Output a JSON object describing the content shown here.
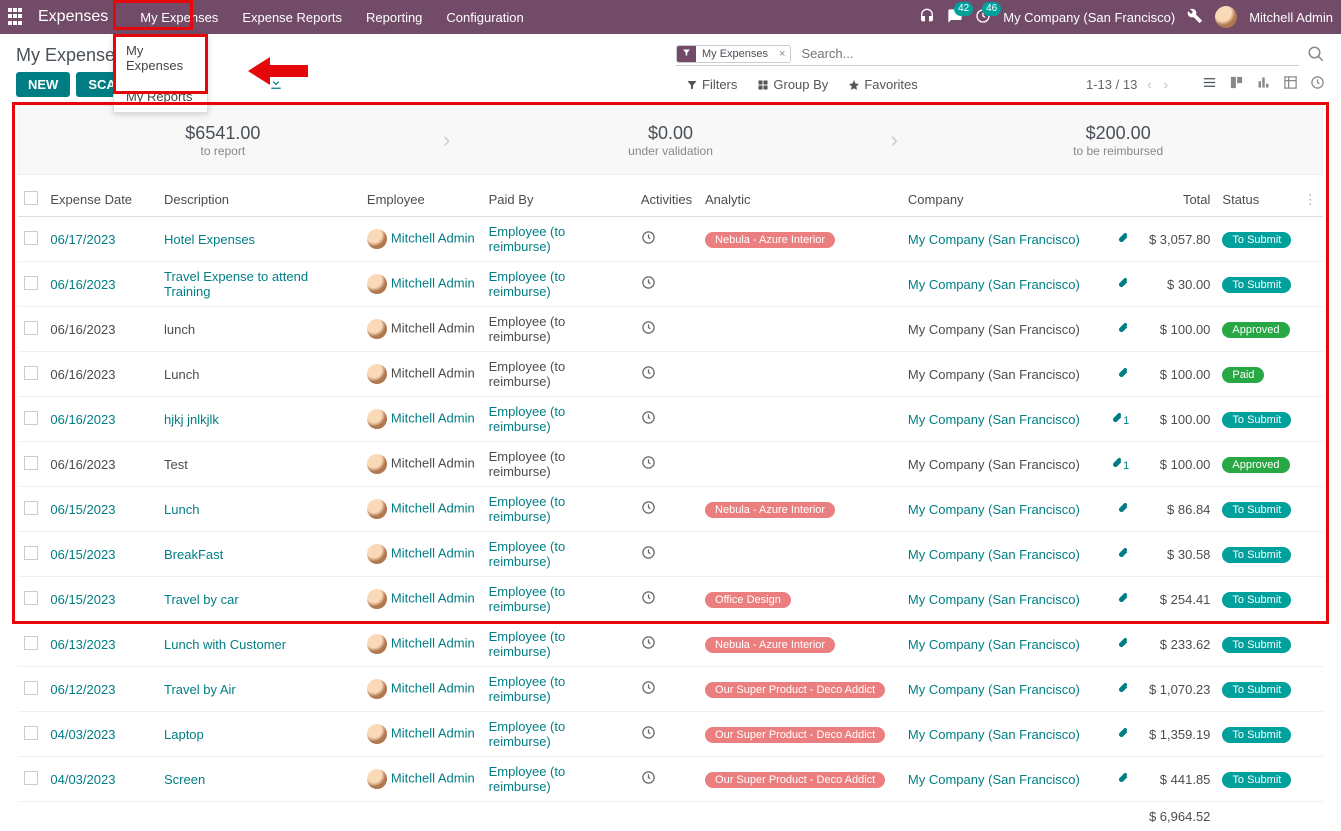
{
  "navbar": {
    "app_name": "Expenses",
    "menus": [
      "My Expenses",
      "Expense Reports",
      "Reporting",
      "Configuration"
    ],
    "chat_badge": "42",
    "activity_badge": "46",
    "company": "My Company (San Francisco)",
    "user": "Mitchell Admin"
  },
  "dropdown": {
    "items": [
      "My Expenses",
      "My Reports"
    ]
  },
  "control_panel": {
    "breadcrumb": "My Expenses",
    "new_btn": "NEW",
    "scan_btn": "SCAN",
    "filter_tag": "My Expenses",
    "search_placeholder": "Search...",
    "filters": "Filters",
    "group_by": "Group By",
    "favorites": "Favorites",
    "pager": "1-13 / 13"
  },
  "summary": [
    {
      "amount": "$6541.00",
      "label": "to report"
    },
    {
      "amount": "$0.00",
      "label": "under validation"
    },
    {
      "amount": "$200.00",
      "label": "to be reimbursed"
    }
  ],
  "columns": {
    "date": "Expense Date",
    "desc": "Description",
    "emp": "Employee",
    "paid": "Paid By",
    "act": "Activities",
    "ana": "Analytic",
    "comp": "Company",
    "total": "Total",
    "status": "Status"
  },
  "rows": [
    {
      "date": "06/17/2023",
      "desc": "Hotel Expenses",
      "emp": "Mitchell Admin",
      "paid": "Employee (to reimburse)",
      "ana": "Nebula - Azure Interior",
      "comp": "My Company (San Francisco)",
      "clip": "1",
      "clip_n": "",
      "total": "$ 3,057.80",
      "status": "To Submit",
      "status_cls": "to-submit",
      "date_link": true,
      "desc_link": true,
      "emp_link": true,
      "paid_link": true,
      "comp_link": true
    },
    {
      "date": "06/16/2023",
      "desc": "Travel Expense to attend Training",
      "emp": "Mitchell Admin",
      "paid": "Employee (to reimburse)",
      "ana": "",
      "comp": "My Company (San Francisco)",
      "clip": "1",
      "clip_n": "",
      "total": "$ 30.00",
      "status": "To Submit",
      "status_cls": "to-submit",
      "date_link": true,
      "desc_link": true,
      "emp_link": true,
      "paid_link": true,
      "comp_link": true
    },
    {
      "date": "06/16/2023",
      "desc": "lunch",
      "emp": "Mitchell Admin",
      "paid": "Employee (to reimburse)",
      "ana": "",
      "comp": "My Company (San Francisco)",
      "clip": "1",
      "clip_n": "",
      "total": "$ 100.00",
      "status": "Approved",
      "status_cls": "approved",
      "date_link": false,
      "desc_link": false,
      "emp_link": false,
      "paid_link": false,
      "comp_link": false
    },
    {
      "date": "06/16/2023",
      "desc": "Lunch",
      "emp": "Mitchell Admin",
      "paid": "Employee (to reimburse)",
      "ana": "",
      "comp": "My Company (San Francisco)",
      "clip": "1",
      "clip_n": "",
      "total": "$ 100.00",
      "status": "Paid",
      "status_cls": "paid",
      "date_link": false,
      "desc_link": false,
      "emp_link": false,
      "paid_link": false,
      "comp_link": false
    },
    {
      "date": "06/16/2023",
      "desc": "hjkj jnlkjlk",
      "emp": "Mitchell Admin",
      "paid": "Employee (to reimburse)",
      "ana": "",
      "comp": "My Company (San Francisco)",
      "clip": "1",
      "clip_n": "1",
      "total": "$ 100.00",
      "status": "To Submit",
      "status_cls": "to-submit",
      "date_link": true,
      "desc_link": true,
      "emp_link": true,
      "paid_link": true,
      "comp_link": true
    },
    {
      "date": "06/16/2023",
      "desc": "Test",
      "emp": "Mitchell Admin",
      "paid": "Employee (to reimburse)",
      "ana": "",
      "comp": "My Company (San Francisco)",
      "clip": "1",
      "clip_n": "1",
      "total": "$ 100.00",
      "status": "Approved",
      "status_cls": "approved",
      "date_link": false,
      "desc_link": false,
      "emp_link": false,
      "paid_link": false,
      "comp_link": false
    },
    {
      "date": "06/15/2023",
      "desc": "Lunch",
      "emp": "Mitchell Admin",
      "paid": "Employee (to reimburse)",
      "ana": "Nebula - Azure Interior",
      "comp": "My Company (San Francisco)",
      "clip": "1",
      "clip_n": "",
      "total": "$ 86.84",
      "status": "To Submit",
      "status_cls": "to-submit",
      "date_link": true,
      "desc_link": true,
      "emp_link": true,
      "paid_link": true,
      "comp_link": true
    },
    {
      "date": "06/15/2023",
      "desc": "BreakFast",
      "emp": "Mitchell Admin",
      "paid": "Employee (to reimburse)",
      "ana": "",
      "comp": "My Company (San Francisco)",
      "clip": "1",
      "clip_n": "",
      "total": "$ 30.58",
      "status": "To Submit",
      "status_cls": "to-submit",
      "date_link": true,
      "desc_link": true,
      "emp_link": true,
      "paid_link": true,
      "comp_link": true
    },
    {
      "date": "06/15/2023",
      "desc": "Travel by car",
      "emp": "Mitchell Admin",
      "paid": "Employee (to reimburse)",
      "ana": "Office Design",
      "comp": "My Company (San Francisco)",
      "clip": "1",
      "clip_n": "",
      "total": "$ 254.41",
      "status": "To Submit",
      "status_cls": "to-submit",
      "date_link": true,
      "desc_link": true,
      "emp_link": true,
      "paid_link": true,
      "comp_link": true
    },
    {
      "date": "06/13/2023",
      "desc": "Lunch with Customer",
      "emp": "Mitchell Admin",
      "paid": "Employee (to reimburse)",
      "ana": "Nebula - Azure Interior",
      "comp": "My Company (San Francisco)",
      "clip": "1",
      "clip_n": "",
      "total": "$ 233.62",
      "status": "To Submit",
      "status_cls": "to-submit",
      "date_link": true,
      "desc_link": true,
      "emp_link": true,
      "paid_link": true,
      "comp_link": true
    },
    {
      "date": "06/12/2023",
      "desc": "Travel by Air",
      "emp": "Mitchell Admin",
      "paid": "Employee (to reimburse)",
      "ana": "Our Super Product - Deco Addict",
      "comp": "My Company (San Francisco)",
      "clip": "1",
      "clip_n": "",
      "total": "$ 1,070.23",
      "status": "To Submit",
      "status_cls": "to-submit",
      "date_link": true,
      "desc_link": true,
      "emp_link": true,
      "paid_link": true,
      "comp_link": true
    },
    {
      "date": "04/03/2023",
      "desc": "Laptop",
      "emp": "Mitchell Admin",
      "paid": "Employee (to reimburse)",
      "ana": "Our Super Product - Deco Addict",
      "comp": "My Company (San Francisco)",
      "clip": "1",
      "clip_n": "",
      "total": "$ 1,359.19",
      "status": "To Submit",
      "status_cls": "to-submit",
      "date_link": true,
      "desc_link": true,
      "emp_link": true,
      "paid_link": true,
      "comp_link": true
    },
    {
      "date": "04/03/2023",
      "desc": "Screen",
      "emp": "Mitchell Admin",
      "paid": "Employee (to reimburse)",
      "ana": "Our Super Product - Deco Addict",
      "comp": "My Company (San Francisco)",
      "clip": "1",
      "clip_n": "",
      "total": "$ 441.85",
      "status": "To Submit",
      "status_cls": "to-submit",
      "date_link": true,
      "desc_link": true,
      "emp_link": true,
      "paid_link": true,
      "comp_link": true
    }
  ],
  "footer_total": "$ 6,964.52"
}
